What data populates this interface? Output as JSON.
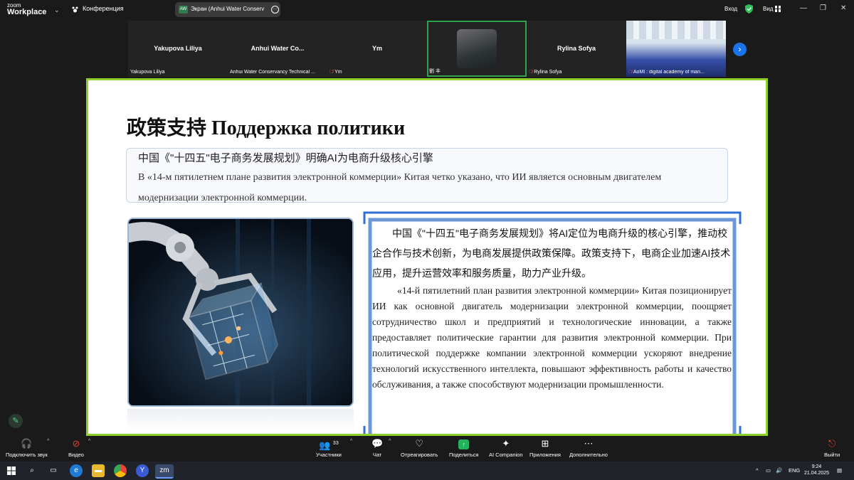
{
  "app": {
    "logo_top": "zoom",
    "logo_bottom": "Workplace",
    "meeting_label": "Конференция"
  },
  "share": {
    "badge": "AW",
    "label": "Экран (Anhui Water Conserv"
  },
  "header_right": {
    "signin": "Вход",
    "view": "Вид"
  },
  "participants": [
    {
      "name": "Yakupova Liliya",
      "caption": "Yakupova Liliya",
      "muted": false
    },
    {
      "name": "Anhui Water Co...",
      "caption": "Anhui Water Conservancy Technical ...",
      "muted": false
    },
    {
      "name": "Ym",
      "caption": "Ym",
      "muted": true
    },
    {
      "name": "",
      "caption": "劉 丰",
      "muted": false
    },
    {
      "name": "Rylina Sofya",
      "caption": "Rylina Sofya",
      "muted": true
    },
    {
      "name": "",
      "caption": "AoMI : digital academy of man...",
      "muted": true
    }
  ],
  "slide": {
    "title": "政策支持 Поддержка политики",
    "summary_cn": "中国《\"十四五\"电子商务发展规划》明确AI为电商升级核心引擎",
    "summary_ru": "В «14-м пятилетнем плане развития электронной коммерции» Китая четко указано, что ИИ является основным двигателем модернизации электронной коммерции.",
    "body_cn": "中国《\"十四五\"电子商务发展规划》将AI定位为电商升级的核心引擎，推动校企合作与技术创新，为电商发展提供政策保障。政策支持下，电商企业加速AI技术应用，提升运营效率和服务质量，助力产业升级。",
    "body_ru": "«14-й пятилетний план развития электронной коммерции» Китая позиционирует ИИ как основной двигатель модернизации электронной коммерции, поощряет сотрудничество школ и предприятий и технологические инновации, а также предоставляет политические гарантии для развития электронной коммерции. При политической поддержке компании электронной коммерции ускоряют внедрение технологий искусственного интеллекта, повышают эффективность работы и качество обслуживания, а также способствуют модернизации промышленности."
  },
  "toolbar": {
    "audio": "Подключить звук",
    "video": "Видео",
    "participants": "Участники",
    "participants_count": "33",
    "chat": "Чат",
    "react": "Отреагировать",
    "share": "Поделиться",
    "ai": "AI Companion",
    "apps": "Приложения",
    "more": "Дополнительно",
    "leave": "Выйти"
  },
  "taskbar": {
    "lang": "ENG",
    "time": "9:24",
    "date": "21.04.2025",
    "zoom_label": "zm"
  },
  "colors": {
    "active_speaker": "#2fa24b",
    "slide_border": "#8ed02a",
    "frame_blue": "#2f6fd6",
    "leave": "#e0443a"
  }
}
